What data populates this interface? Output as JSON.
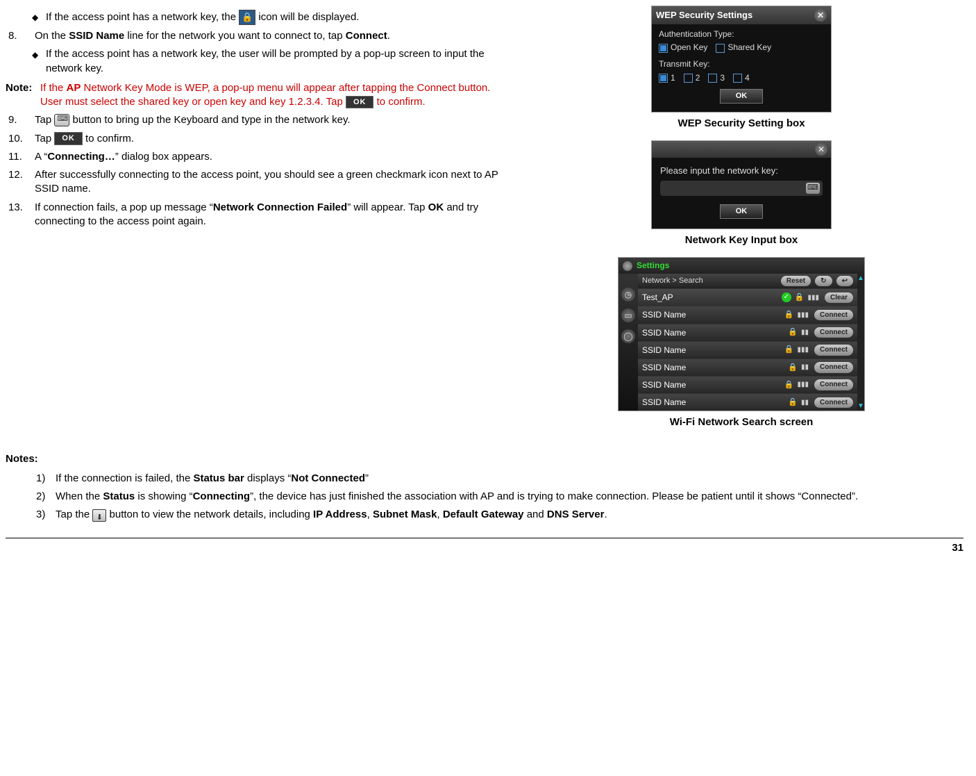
{
  "page_number": "31",
  "left": {
    "bullet_lock": "If the access point has a network key, the ",
    "bullet_lock_tail": " icon will be displayed.",
    "step8_num": "8.",
    "step8": "On the <b>SSID Name</b> line for the network you want to connect to, tap <b>Connect</b>.",
    "step8_sub": "If the access point has a network key, the user will be prompted by a pop-up screen to input the network key.",
    "note_label": "Note:",
    "note_text": "If the <b>AP</b> Network Key Mode is WEP, a pop-up menu will appear after tapping the Connect button. User must select the shared key or open key and key 1.2.3.4. Tap ",
    "note_tail": " to confirm.",
    "step9_num": "9.",
    "step9_a": "Tap ",
    "step9_b": " button to bring up the Keyboard and type in the network key.",
    "step10_num": "10.",
    "step10_a": "Tap ",
    "step10_b": " to confirm.",
    "step11_num": "11.",
    "step11": "A &ldquo;<b>Connecting&hellip;</b>&rdquo; dialog box appears.",
    "step12_num": "12.",
    "step12": "After successfully connecting to the access point, you should see a green checkmark icon next to AP SSID name.",
    "step13_num": "13.",
    "step13": "If connection fails, a pop up message &ldquo;<b>Network Connection Failed</b>&rdquo; will appear.  Tap <b>OK</b> and try connecting to the access point again."
  },
  "captions": {
    "wep": "WEP Security Setting box",
    "netkey": "Network Key Input box",
    "search": "Wi-Fi Network Search screen"
  },
  "wep": {
    "title": "WEP Security Settings",
    "auth_label": "Authentication Type:",
    "open": "Open Key",
    "shared": "Shared Key",
    "transmit": "Transmit Key:",
    "k1": "1",
    "k2": "2",
    "k3": "3",
    "k4": "4",
    "ok": "OK"
  },
  "netkey": {
    "prompt": "Please input the network key:",
    "ok": "OK"
  },
  "search": {
    "settings": "Settings",
    "breadcrumb": "Network > Search",
    "reset": "Reset",
    "clear": "Clear",
    "connect": "Connect",
    "test_ap": "Test_AP",
    "ssid": "SSID Name",
    "refresh": "↻",
    "back": "↩"
  },
  "notes": {
    "heading": "Notes:",
    "n1_num": "1)",
    "n1": "If the connection is failed, the <b>Status bar</b> displays &ldquo;<b>Not Connected</b>&rdquo;",
    "n2_num": "2)",
    "n2": "When the <b>Status</b> is showing &ldquo;<b>Connecting</b>&rdquo;, the device has just finished the association with AP and is trying to make connection.  Please be patient until it shows &ldquo;Connected&rdquo;.",
    "n3_num": "3)",
    "n3_a": "Tap the ",
    "n3_b": " button to view the network details, including <b>IP Address</b>, <b>Subnet Mask</b>, <b>Default Gateway</b> and <b>DNS Server</b>."
  },
  "ok_label": "OK"
}
